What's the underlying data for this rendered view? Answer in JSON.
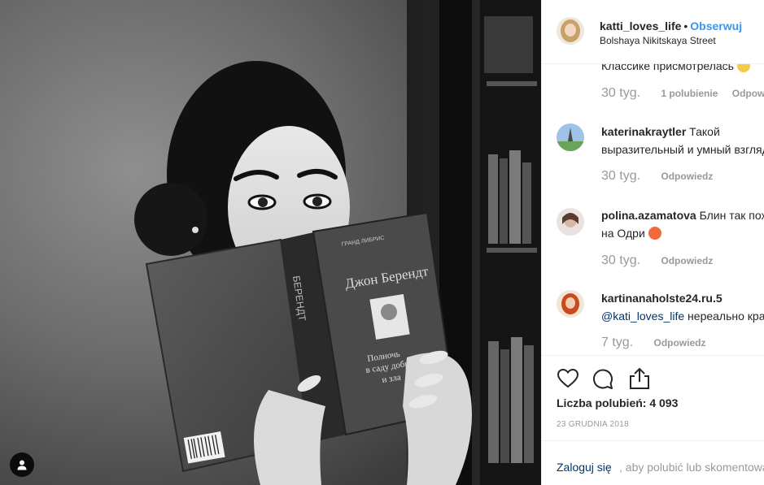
{
  "header": {
    "username": "katti_loves_life",
    "separator": "•",
    "follow": "Obserwuj",
    "location": "Bolshaya Nikitskaya Street"
  },
  "book": {
    "publisher": "ГРАНД  ЛИБРИС",
    "author": "Джон Берендт",
    "title_line1": "Полночь",
    "title_line2": "в саду добра",
    "title_line3": "и зла",
    "spine": "БЕРЕНДТ"
  },
  "comments": [
    {
      "username": "",
      "text": "Классике присмотрелась",
      "time": "30 tyg.",
      "likes": "1 polubienie",
      "reply": "Odpowiedz"
    },
    {
      "username": "katerinakraytler",
      "text_line1": " Такой",
      "text_line2": "выразительный и умный взгляд",
      "time": "30 tyg.",
      "reply": "Odpowiedz"
    },
    {
      "username": "polina.azamatova",
      "text_line1": " Блин так похожа",
      "text_line2": "на Одри ",
      "time": "30 tyg.",
      "reply": "Odpowiedz"
    },
    {
      "username": "kartinanaholste24.ru.5",
      "mention": "@kati_loves_life",
      "text_line2": " нереально красиво",
      "time": "7 tyg.",
      "reply": "Odpowiedz"
    }
  ],
  "likes": {
    "label": "Liczba polubień: ",
    "count": "4 093"
  },
  "date": "23 GRUDNIA 2018",
  "login": {
    "link": "Zaloguj się",
    "rest": ", aby polubić lub skomentować."
  },
  "icons": {
    "like": "heart-icon",
    "comment": "comment-bubble-icon",
    "share": "share-upload-icon",
    "tagged_users": "user-icon"
  },
  "colors": {
    "link_blue": "#3897f0",
    "dark_link": "#003569",
    "muted": "#999999",
    "border": "#efefef"
  }
}
